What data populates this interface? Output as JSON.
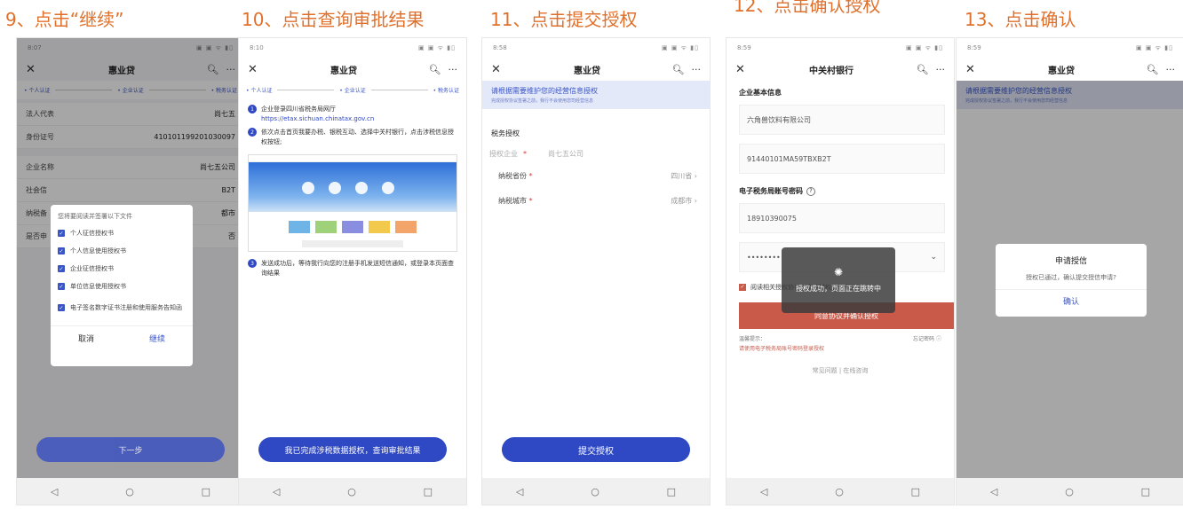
{
  "titles": [
    "9、点击“继续”",
    "10、点击查询审批结果",
    "11、点击提交授权",
    "12、点击确认授权",
    "13、点击确认"
  ],
  "accent": "#e0712c",
  "blue": "#2f48c4",
  "p1": {
    "time": "8:07",
    "app_title": "惠业贷",
    "steps": [
      "• 个人认证",
      "• 企业认证",
      "• 税务认证"
    ],
    "rows": [
      {
        "k": "法人代表",
        "v": "尚七五"
      },
      {
        "k": "身份证号",
        "v": "410101199201030097"
      },
      {
        "k": "企业名称",
        "v": "尚七五公司"
      },
      {
        "k": "社会信",
        "v": "B2T"
      },
      {
        "k": "纳税备",
        "v": "都市"
      },
      {
        "k": "是否申",
        "v": "否"
      }
    ],
    "modal": {
      "header": "您将要阅读并签署以下文件",
      "items": [
        "个人征信授权书",
        "个人信息使用授权书",
        "企业征信授权书",
        "单位信息使用授权书",
        "电子签名数字证书注册和使用服务告知函"
      ],
      "cancel": "取消",
      "continue": "继续"
    },
    "next": "下一步"
  },
  "p2": {
    "time": "8:10",
    "app_title": "惠业贷",
    "steps": [
      "• 个人认证",
      "• 企业认证",
      "• 税务认证"
    ],
    "inst1": "企业登录四川省税务局网厅",
    "url": "https://etax.sichuan.chinatax.gov.cn",
    "inst2": "依次点击首页我要办税、银税互动、选择中关村银行，点击涉税信息授权按钮;",
    "inst3": "发送成功后，等待我行向您的注册手机发送短信通知，或登录本页面查询结果",
    "btn": "我已完成涉税数据授权，查询审批结果"
  },
  "p3": {
    "time": "8:58",
    "app_title": "惠业贷",
    "banner1": "请根据需要维护您的经营信息授权",
    "banner2": "完成授权协议签署之前，我行不会使用您司经营信息",
    "section": "税务授权",
    "company_label": "授权企业",
    "company_value": "尚七五公司",
    "province_label": "纳税省份",
    "province_value": "四川省",
    "city_label": "纳税城市",
    "city_value": "成都市",
    "star": "*",
    "btn": "提交授权"
  },
  "p4": {
    "time": "8:59",
    "app_title": "中关村银行",
    "section1": "企业基本信息",
    "company": "六角兽饮料有限公司",
    "code": "91440101MA59TBXB2T",
    "section2": "电子税务局账号密码",
    "phone": "18910390075",
    "password": "••••••••",
    "toast": "授权成功，页面正在跳转中",
    "agree": "阅读相关授权协议《企业授权协议书》",
    "btn": "同意协议并确认授权",
    "tip_label": "温馨提示：",
    "tip_text": "请使用电子税务局账号密码登录授权",
    "forgot": "忘记密码",
    "links": "常见问题 | 在线咨询"
  },
  "p5": {
    "time": "8:59",
    "app_title": "惠业贷",
    "banner1": "请根据需要维护您的经营信息授权",
    "banner2": "完成授权协议签署之前，我行不会使用您司经营信息",
    "dialog_title": "申请授信",
    "dialog_text": "授权已通过，确认提交授信申请?",
    "confirm": "确认"
  },
  "nav": {
    "back": "◁",
    "home": "○",
    "recent": "□"
  },
  "status_icons": "▣ ▣ ᯤ ▮▯"
}
